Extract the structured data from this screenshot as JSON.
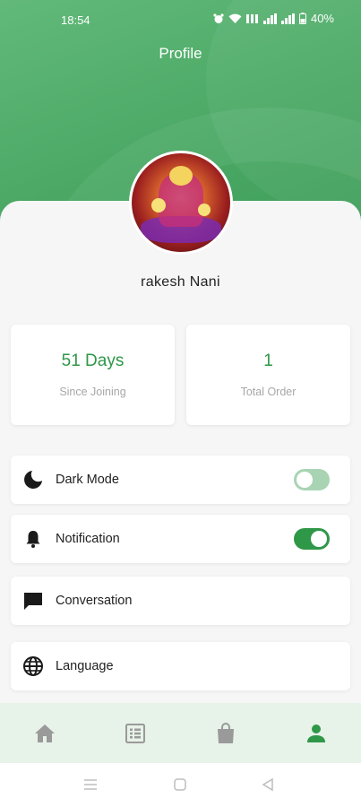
{
  "status_bar": {
    "time": "18:54",
    "battery": "40%"
  },
  "header": {
    "title": "Profile"
  },
  "profile": {
    "name": "rakesh Nani"
  },
  "stats": [
    {
      "value": "51 Days",
      "label": "Since Joining"
    },
    {
      "value": "1",
      "label": "Total Order"
    }
  ],
  "settings": {
    "dark_mode": {
      "label": "Dark Mode",
      "icon": "moon-icon",
      "enabled": false
    },
    "notification": {
      "label": "Notification",
      "icon": "bell-icon",
      "enabled": true
    },
    "conversation": {
      "label": "Conversation",
      "icon": "chat-icon"
    },
    "language": {
      "label": "Language",
      "icon": "globe-icon"
    }
  },
  "bottom_nav": {
    "items": [
      {
        "icon": "home-icon",
        "active": false
      },
      {
        "icon": "list-icon",
        "active": false
      },
      {
        "icon": "bag-icon",
        "active": false
      },
      {
        "icon": "person-icon",
        "active": true
      }
    ]
  },
  "colors": {
    "accent": "#2e9748",
    "header": "#4aa864",
    "nav_inactive": "#9a9a9a",
    "nav_background": "#e7f2e8"
  }
}
